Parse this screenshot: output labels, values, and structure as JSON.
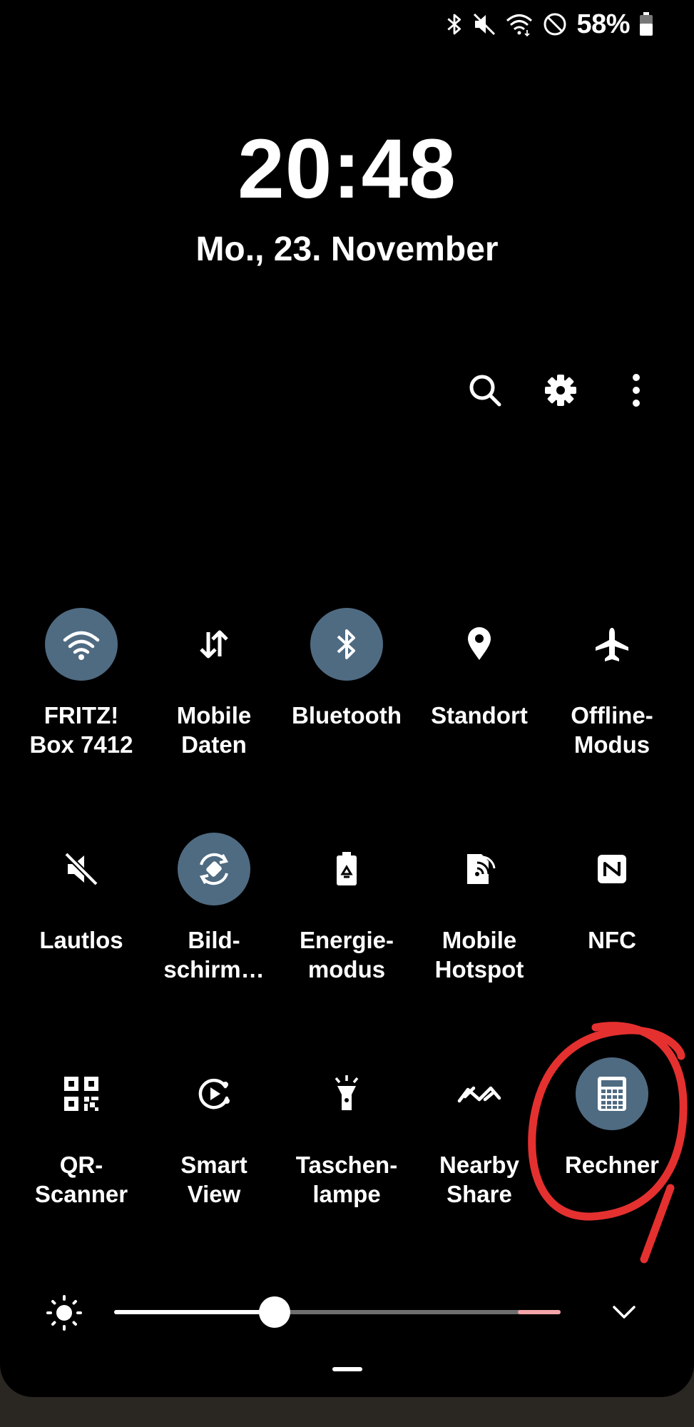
{
  "status_bar": {
    "battery_percent": "58%",
    "battery_level": 0.58,
    "icons": [
      "bluetooth-icon",
      "mute-icon",
      "wifi-data-icon",
      "do-not-disturb-icon",
      "battery-icon"
    ]
  },
  "lockscreen": {
    "time": "20:48",
    "date": "Mo., 23. November"
  },
  "toolbar": {
    "icons": [
      "search-icon",
      "gear-icon",
      "more-vertical-icon"
    ]
  },
  "tiles": [
    {
      "id": "wifi",
      "label": "FRITZ!\nBox 7412",
      "icon": "wifi-icon",
      "active": true
    },
    {
      "id": "mobile-data",
      "label": "Mobile\nDaten",
      "icon": "mobile-data-icon",
      "active": false
    },
    {
      "id": "bluetooth",
      "label": "Bluetooth",
      "icon": "bluetooth-icon",
      "active": true
    },
    {
      "id": "location",
      "label": "Standort",
      "icon": "location-pin-icon",
      "active": false
    },
    {
      "id": "airplane",
      "label": "Offline-\nModus",
      "icon": "airplane-icon",
      "active": false
    },
    {
      "id": "mute",
      "label": "Lautlos",
      "icon": "mute-icon",
      "active": false
    },
    {
      "id": "rotation",
      "label": "Bild-\nschirm…",
      "icon": "auto-rotate-icon",
      "active": true
    },
    {
      "id": "power-mode",
      "label": "Energie-\nmodus",
      "icon": "battery-saver-icon",
      "active": false
    },
    {
      "id": "hotspot",
      "label": "Mobile\nHotspot",
      "icon": "hotspot-icon",
      "active": false
    },
    {
      "id": "nfc",
      "label": "NFC",
      "icon": "nfc-icon",
      "active": false
    },
    {
      "id": "qr-scanner",
      "label": "QR-\nScanner",
      "icon": "qr-code-icon",
      "active": false
    },
    {
      "id": "smart-view",
      "label": "Smart\nView",
      "icon": "smart-view-icon",
      "active": false
    },
    {
      "id": "flashlight",
      "label": "Taschen-\nlampe",
      "icon": "flashlight-icon",
      "active": false
    },
    {
      "id": "nearby-share",
      "label": "Nearby\nShare",
      "icon": "nearby-share-icon",
      "active": false
    },
    {
      "id": "calculator",
      "label": "Rechner",
      "icon": "calculator-icon",
      "active": true
    }
  ],
  "brightness": {
    "level": 0.36,
    "icon": "brightness-sun-icon",
    "expand_icon": "chevron-down-icon"
  },
  "colors": {
    "panel_background": "#000000",
    "tile_active": "#4f6b82",
    "annotation": "#e53030",
    "brightness_hot": "#f3a4a8"
  }
}
